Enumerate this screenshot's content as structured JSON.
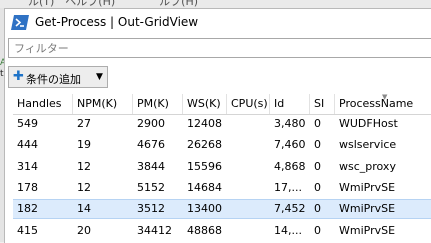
{
  "window": {
    "title": "Get-Process | Out-GridView"
  },
  "filter": {
    "placeholder": "フィルター",
    "value": ""
  },
  "add_criteria": {
    "label": "条件の追加"
  },
  "grid": {
    "columns": [
      "Handles",
      "NPM(K)",
      "PM(K)",
      "WS(K)",
      "CPU(s)",
      "Id",
      "SI",
      "ProcessName"
    ],
    "sorted_column": "ProcessName",
    "sort_direction": "descending",
    "rows": [
      {
        "cells": [
          "549",
          "27",
          "2900",
          "12408",
          "",
          "3,480",
          "0",
          "WUDFHost"
        ],
        "selected": false
      },
      {
        "cells": [
          "444",
          "19",
          "4676",
          "26268",
          "",
          "7,460",
          "0",
          "wslservice"
        ],
        "selected": false
      },
      {
        "cells": [
          "314",
          "12",
          "3844",
          "15596",
          "",
          "4,868",
          "0",
          "wsc_proxy"
        ],
        "selected": false
      },
      {
        "cells": [
          "178",
          "12",
          "5152",
          "14684",
          "",
          "17,...",
          "0",
          "WmiPrvSE"
        ],
        "selected": false
      },
      {
        "cells": [
          "182",
          "14",
          "3512",
          "13400",
          "",
          "7,452",
          "0",
          "WmiPrvSE"
        ],
        "selected": true
      },
      {
        "cells": [
          "415",
          "20",
          "34412",
          "48868",
          "",
          "14,...",
          "0",
          "WmiPrvSE"
        ],
        "selected": false
      }
    ]
  }
}
